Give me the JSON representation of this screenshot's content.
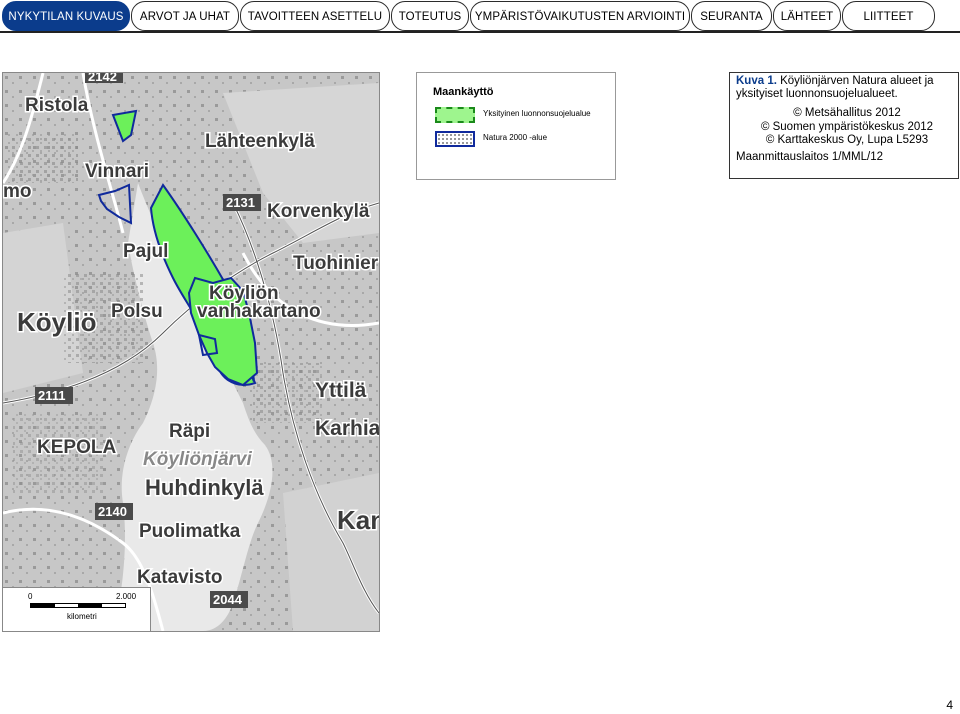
{
  "tabs": [
    {
      "label": "NYKYTILAN KUVAUS",
      "active": true
    },
    {
      "label": "ARVOT JA UHAT",
      "active": false
    },
    {
      "label": "TAVOITTEEN ASETTELU",
      "active": false
    },
    {
      "label": "TOTEUTUS",
      "active": false
    },
    {
      "label": "YMPÄRISTÖVAIKUTUSTEN ARVIOINTI",
      "active": false
    },
    {
      "label": "SEURANTA",
      "active": false
    },
    {
      "label": "LÄHTEET",
      "active": false
    },
    {
      "label": "LIITTEET",
      "active": false
    }
  ],
  "legend": {
    "title": "Maankäyttö",
    "items": [
      {
        "label": "Yksityinen luonnonsuojelualue",
        "color": "#9ef58e"
      },
      {
        "label": "Natura 2000 -alue",
        "color": "#102a9c"
      }
    ]
  },
  "caption": {
    "label": "Kuva 1.",
    "text": " Köyliönjärven Natura alueet ja yksityiset luonnonsuojelualueet.",
    "credits": [
      "© Metsähallitus 2012",
      "© Suomen ympäristökeskus 2012",
      "© Karttakeskus Oy, Lupa L5293",
      "Maanmittauslaitos 1/MML/12"
    ]
  },
  "map": {
    "place_labels": [
      "Ristola",
      "Lähteenkylä",
      "Vinnari",
      "mo",
      "Korvenkylä",
      "Pajul",
      "Tuohinier",
      "Köyliö",
      "Polsu",
      "Köyliön",
      "vanhakartano",
      "Yttilä",
      "Karhia",
      "KEPOLA",
      "Räpi",
      "Köyliönjärvi",
      "Huhdinkylä",
      "Puolimatka",
      "Katavisto",
      "Kan"
    ],
    "road_labels": [
      "2142",
      "2131",
      "2111",
      "2140",
      "2044"
    ]
  },
  "scale": {
    "start": "0",
    "end": "2.000",
    "unit": "kilometri"
  },
  "page_number": "4"
}
